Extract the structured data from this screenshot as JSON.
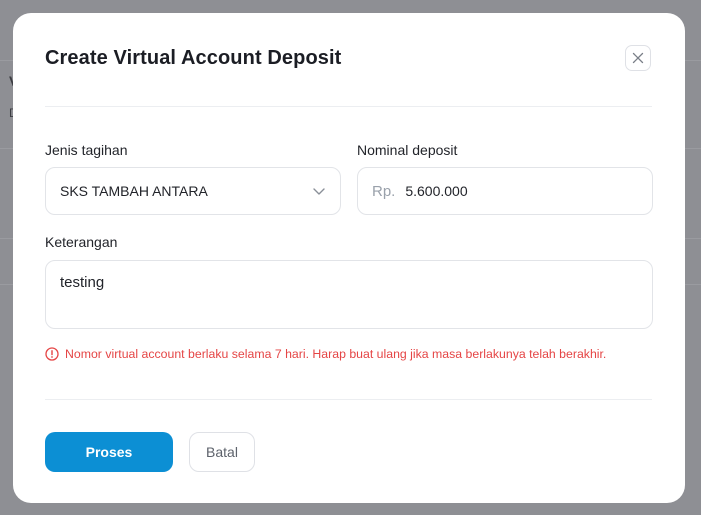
{
  "modal": {
    "title": "Create Virtual Account Deposit"
  },
  "form": {
    "jenis_tagihan": {
      "label": "Jenis tagihan",
      "value": "SKS TAMBAH ANTARA"
    },
    "nominal_deposit": {
      "label": "Nominal deposit",
      "prefix": "Rp.",
      "value": "5.600.000"
    },
    "keterangan": {
      "label": "Keterangan",
      "value": "testing"
    },
    "warning": "Nomor virtual account berlaku selama 7 hari. Harap buat ulang jika masa berlakunya telah berakhir."
  },
  "actions": {
    "submit_label": "Proses",
    "cancel_label": "Batal"
  },
  "background": {
    "glyph_1": "V",
    "glyph_2": "D"
  },
  "colors": {
    "primary": "#0c8fd4",
    "error": "#e54545",
    "overlay": "#8e8f94"
  },
  "icons": {
    "close": "close-icon",
    "select_arrow": "chevron-down-icon",
    "warning": "alert-circle-icon"
  }
}
